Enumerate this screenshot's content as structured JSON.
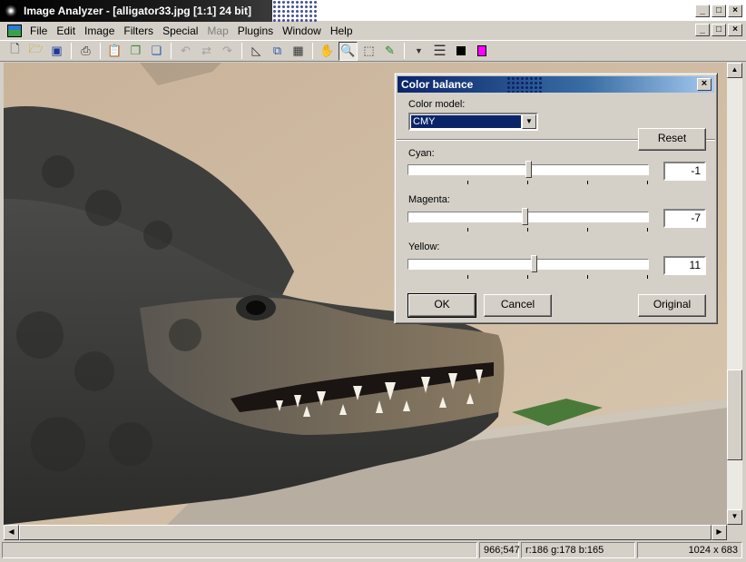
{
  "window": {
    "title": "Image Analyzer - [alligator33.jpg [1:1] 24 bit]",
    "controls": [
      "_",
      "□",
      "×"
    ]
  },
  "menu": {
    "items": [
      "File",
      "Edit",
      "Image",
      "Filters",
      "Special",
      "Map",
      "Plugins",
      "Window",
      "Help"
    ],
    "disabled": [
      "Map"
    ]
  },
  "toolbar": {
    "icons": [
      "new-file-icon",
      "open-folder-icon",
      "save-icon",
      "scanner-icon",
      "paste-icon",
      "copy-icon",
      "duplicate-icon",
      "undo-icon",
      "redo-icon",
      "repeat-icon",
      "curve-icon",
      "resize-icon",
      "qr-icon",
      "hand-icon",
      "zoom-icon",
      "select-icon",
      "eyedropper-icon",
      "dropdown-icon",
      "lines-icon",
      "shapes-icon",
      "color-swatch-icon"
    ],
    "colors": {
      "swatch": "#ff00ff"
    }
  },
  "status": {
    "blank": "",
    "coords": "966;547",
    "rgb": "r:186 g:178 b:165",
    "size": "1024 x 683"
  },
  "dialog": {
    "title": "Color balance",
    "color_model_label": "Color model:",
    "color_model_value": "CMY",
    "reset_label": "Reset",
    "sliders": [
      {
        "label": "Cyan:",
        "value": "-1"
      },
      {
        "label": "Magenta:",
        "value": "-7"
      },
      {
        "label": "Yellow:",
        "value": "11"
      }
    ],
    "ok_label": "OK",
    "cancel_label": "Cancel",
    "original_label": "Original"
  }
}
